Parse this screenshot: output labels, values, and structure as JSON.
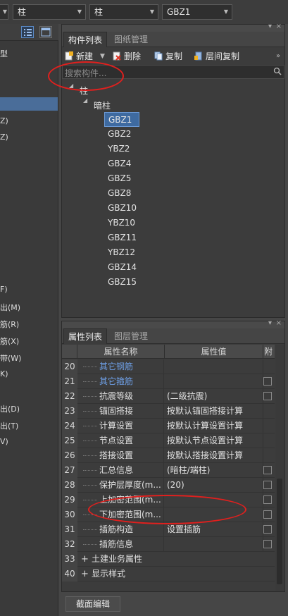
{
  "top_combos": [
    {
      "value": "柱"
    },
    {
      "value": "柱"
    },
    {
      "value": "GBZ1"
    }
  ],
  "left_pane": {
    "items": [
      "型",
      "Z)",
      "Z)",
      "F)",
      "出(M)",
      "筋(R)",
      "筋(X)",
      "带(W)",
      "K)",
      "出(D)",
      "出(T)",
      "V)"
    ]
  },
  "component_panel": {
    "tabs": [
      "构件列表",
      "图纸管理"
    ],
    "toolbar": {
      "new": "新建",
      "delete": "删除",
      "copy": "复制",
      "floor_copy": "层间复制"
    },
    "search_placeholder": "搜索构件...",
    "tree": {
      "root": "柱",
      "group": "暗柱",
      "items": [
        "GBZ1",
        "GBZ2",
        "YBZ2",
        "GBZ4",
        "GBZ5",
        "GBZ8",
        "GBZ10",
        "YBZ10",
        "GBZ11",
        "YBZ12",
        "GBZ14",
        "GBZ15"
      ],
      "selected": "GBZ1"
    }
  },
  "property_panel": {
    "tabs": [
      "属性列表",
      "图层管理"
    ],
    "headers": {
      "name": "属性名称",
      "value": "属性值",
      "extra": "附加"
    },
    "rows": [
      {
        "num": "20",
        "name": "其它钢筋",
        "value": "",
        "blue": true,
        "check": false
      },
      {
        "num": "21",
        "name": "其它箍筋",
        "value": "",
        "blue": true,
        "check": true
      },
      {
        "num": "22",
        "name": "抗震等级",
        "value": "(二级抗震)",
        "blue": false,
        "check": true
      },
      {
        "num": "23",
        "name": "锚固搭接",
        "value": "按默认锚固搭接计算",
        "blue": false,
        "check": false
      },
      {
        "num": "24",
        "name": "计算设置",
        "value": "按默认计算设置计算",
        "blue": false,
        "check": false
      },
      {
        "num": "25",
        "name": "节点设置",
        "value": "按默认节点设置计算",
        "blue": false,
        "check": false
      },
      {
        "num": "26",
        "name": "搭接设置",
        "value": "按默认搭接设置计算",
        "blue": false,
        "check": false
      },
      {
        "num": "27",
        "name": "汇总信息",
        "value": "(暗柱/端柱)",
        "blue": false,
        "check": true
      },
      {
        "num": "28",
        "name": "保护层厚度(m...",
        "value": "(20)",
        "blue": false,
        "check": true
      },
      {
        "num": "29",
        "name": "上加密范围(m...",
        "value": "",
        "blue": false,
        "check": true
      },
      {
        "num": "30",
        "name": "下加密范围(m...",
        "value": "",
        "blue": false,
        "check": true
      },
      {
        "num": "31",
        "name": "插筋构造",
        "value": "设置插筋",
        "blue": false,
        "check": true
      },
      {
        "num": "32",
        "name": "插筋信息",
        "value": "",
        "blue": false,
        "check": true
      }
    ],
    "groups": [
      {
        "num": "33",
        "name": "土建业务属性"
      },
      {
        "num": "40",
        "name": "显示样式"
      }
    ]
  },
  "bottom_button": "截面编辑",
  "colors": {
    "accent": "#3e6aa0",
    "highlight": "#e0201e",
    "link_blue": "#6e9fe6"
  }
}
